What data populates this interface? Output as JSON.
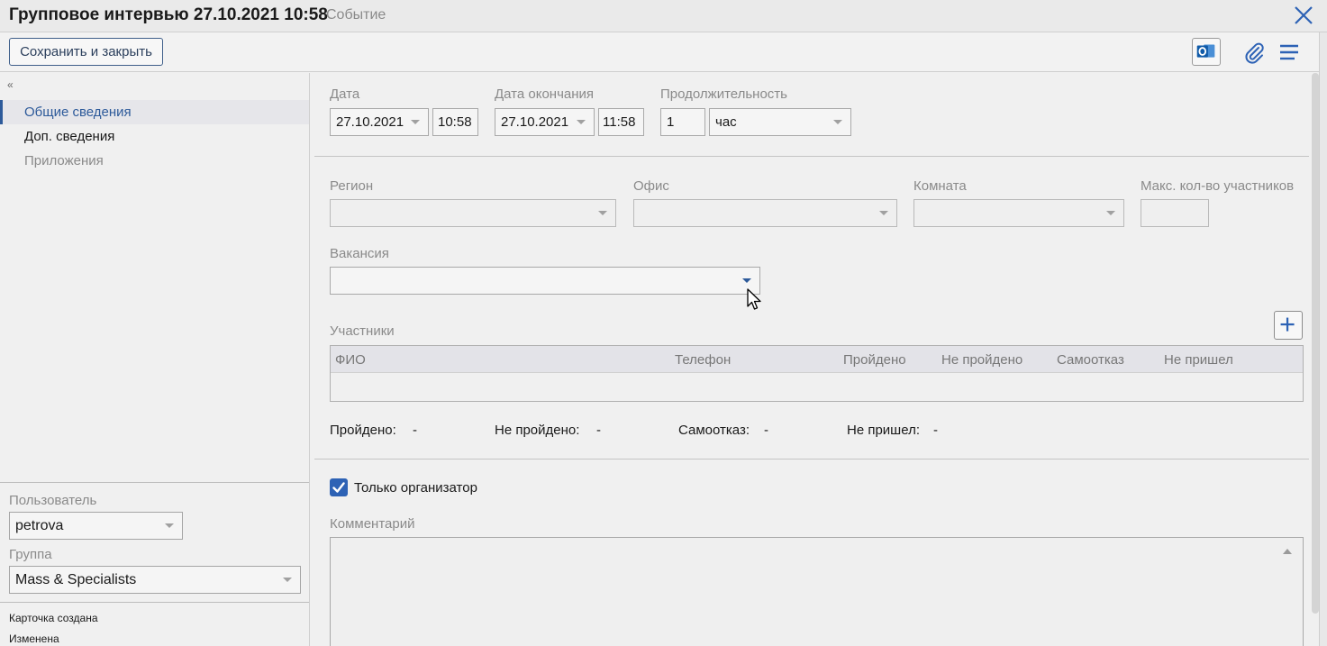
{
  "window": {
    "title": "Групповое интервью 27.10.2021 10:58",
    "subtitle": "Событие"
  },
  "toolbar": {
    "save_label": "Сохранить и закрыть",
    "icons": [
      "outlook-icon",
      "paperclip-icon",
      "menu-icon",
      "close-icon"
    ]
  },
  "sidebar": {
    "collapse_icon": "«",
    "items": [
      {
        "label": "Общие сведения",
        "state": "active"
      },
      {
        "label": "Доп. сведения",
        "state": "normal"
      },
      {
        "label": "Приложения",
        "state": "disabled"
      }
    ],
    "user_label": "Пользователь",
    "user_value": "petrova",
    "group_label": "Группа",
    "group_value": "Mass & Specialists",
    "created_label": "Карточка создана",
    "modified_label": "Изменена"
  },
  "form": {
    "date_label": "Дата",
    "date_value": "27.10.2021",
    "time_value": "10:58",
    "end_date_label": "Дата окончания",
    "end_date_value": "27.10.2021",
    "end_time_value": "11:58",
    "duration_label": "Продолжительность",
    "duration_value": "1",
    "duration_unit": "час",
    "region_label": "Регион",
    "region_value": "",
    "office_label": "Офис",
    "office_value": "",
    "room_label": "Комната",
    "room_value": "",
    "max_label": "Макс. кол-во участников",
    "max_value": "",
    "vacancy_label": "Вакансия",
    "vacancy_value": "",
    "participants_label": "Участники",
    "columns": [
      "ФИО",
      "Телефон",
      "Пройдено",
      "Не пройдено",
      "Самоотказ",
      "Не пришел"
    ],
    "rows": [],
    "stats": [
      {
        "label": "Пройдено:",
        "value": "-"
      },
      {
        "label": "Не пройдено:",
        "value": "-"
      },
      {
        "label": "Самоотказ:",
        "value": "-"
      },
      {
        "label": "Не пришел:",
        "value": "-"
      }
    ],
    "organizer_only_label": "Только организатор",
    "organizer_only_checked": true,
    "comment_label": "Комментарий",
    "comment_value": ""
  },
  "colors": {
    "accent": "#2d5a9a",
    "checkbox": "#2d62b5",
    "outlook": "#0f5aa8",
    "muted_text": "#8a8a8a"
  }
}
